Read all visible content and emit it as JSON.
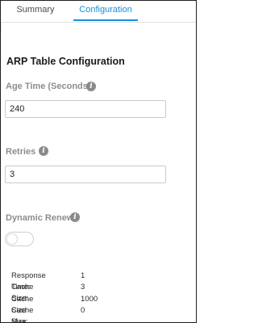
{
  "tabs": [
    {
      "label": "Summary",
      "active": false
    },
    {
      "label": "Configuration",
      "active": true
    }
  ],
  "section_title": "ARP Table Configuration",
  "fields": {
    "age_time": {
      "label": "Age Time (Seconds)",
      "value": "240"
    },
    "retries": {
      "label": "Retries",
      "value": "3"
    },
    "dynamic_renew": {
      "label": "Dynamic Renew",
      "enabled": false
    }
  },
  "info_icon": "info-icon",
  "stats": [
    {
      "label": "Response Time:",
      "value": "1"
    },
    {
      "label": "Cache Size:",
      "value": "3"
    },
    {
      "label": "Cache Size Max:",
      "value": "1000"
    },
    {
      "label": "Cache Size Min:",
      "value": "0"
    }
  ],
  "colors": {
    "accent": "#1a8fdb",
    "label_gray": "#8d8d8d",
    "icon_gray": "#8a8a8a"
  }
}
